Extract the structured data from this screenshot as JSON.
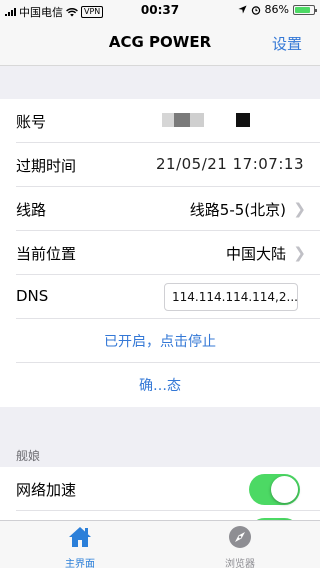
{
  "status_bar": {
    "carrier": "中国电信",
    "vpn": "VPN",
    "time": "00:37",
    "battery": "86%",
    "battery_level": 0.86
  },
  "nav": {
    "title": "ACG POWER",
    "settings_label": "设置"
  },
  "info": {
    "account_label": "账号",
    "expiry_label": "过期时间",
    "expiry_value": "21/05/21 17:07:13",
    "route_label": "线路",
    "route_value": "线路5-5(北京)",
    "location_label": "当前位置",
    "location_value": "中国大陆",
    "dns_label": "DNS",
    "dns_value": "114.114.114.114,2...",
    "toggle_action": "已开启，点击停止",
    "confirm_action": "确…态"
  },
  "section": {
    "header": "舰娘",
    "network_boost_label": "网络加速",
    "network_boost_on": true
  },
  "tabs": [
    {
      "label": "主界面",
      "icon": "home-icon",
      "active": true
    },
    {
      "label": "浏览器",
      "icon": "compass-icon",
      "active": false
    }
  ],
  "colors": {
    "accent": "#3478d6",
    "toggle_on": "#4cd964",
    "background": "#efeff4"
  }
}
